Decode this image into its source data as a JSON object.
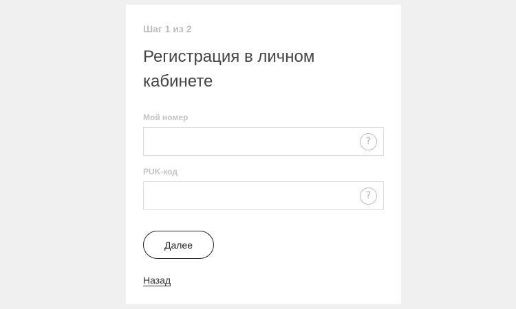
{
  "step_indicator": "Шаг 1 из 2",
  "title": "Регистрация в личном кабинете",
  "fields": {
    "phone": {
      "label": "Мой номер",
      "value": "",
      "placeholder": "",
      "help_icon": "question-circle"
    },
    "puk": {
      "label": "PUK-код",
      "value": "",
      "placeholder": "",
      "help_icon": "question-circle"
    }
  },
  "help_glyph": "?",
  "buttons": {
    "next_label": "Далее",
    "back_label": "Назад"
  },
  "colors": {
    "background": "#f0f0f0",
    "card": "#ffffff",
    "text_dark": "#444444",
    "text_muted": "#bdbdbd",
    "border": "#dcdcdc",
    "button_border": "#222222"
  }
}
